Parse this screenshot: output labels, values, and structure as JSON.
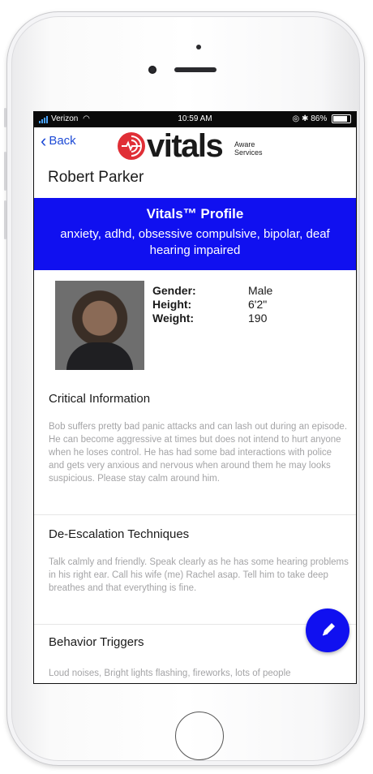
{
  "status_bar": {
    "carrier": "Verizon",
    "time": "10:59 AM",
    "battery": "86%"
  },
  "nav": {
    "back_label": "Back",
    "logo_text": "vitals",
    "logo_tag_1": "Aware",
    "logo_tag_2": "Services"
  },
  "person": {
    "name": "Robert Parker"
  },
  "profile_banner": {
    "title": "Vitals™ Profile",
    "tags": "anxiety, adhd, obsessive compulsive, bipolar, deaf hearing impaired"
  },
  "details": [
    {
      "label": "Gender:",
      "value": "Male"
    },
    {
      "label": "Height:",
      "value": "6'2\""
    },
    {
      "label": "Weight:",
      "value": "190"
    }
  ],
  "sections": [
    {
      "title": "Critical Information",
      "body": "Bob suffers pretty bad panic attacks and can lash out during an episode. He can become aggressive at times but does not intend to hurt anyone when he loses control. He has had some bad interactions with police and gets very anxious and nervous when around them he may looks suspicious. Please stay calm around him."
    },
    {
      "title": "De-Escalation Techniques",
      "body": "Talk calmly and friendly. Speak clearly as he has some hearing problems in his right ear. Call his wife (me) Rachel asap. Tell him to take deep breathes and that everything is fine."
    },
    {
      "title": "Behavior Triggers",
      "body": "Loud noises, Bright lights flashing, fireworks, lots of people"
    }
  ],
  "colors": {
    "banner": "#1010f0",
    "logo_red": "#e02f36",
    "link_blue": "#1e4bd6"
  },
  "icons": {
    "edit": "pencil-icon",
    "back": "chevron-left-icon"
  }
}
